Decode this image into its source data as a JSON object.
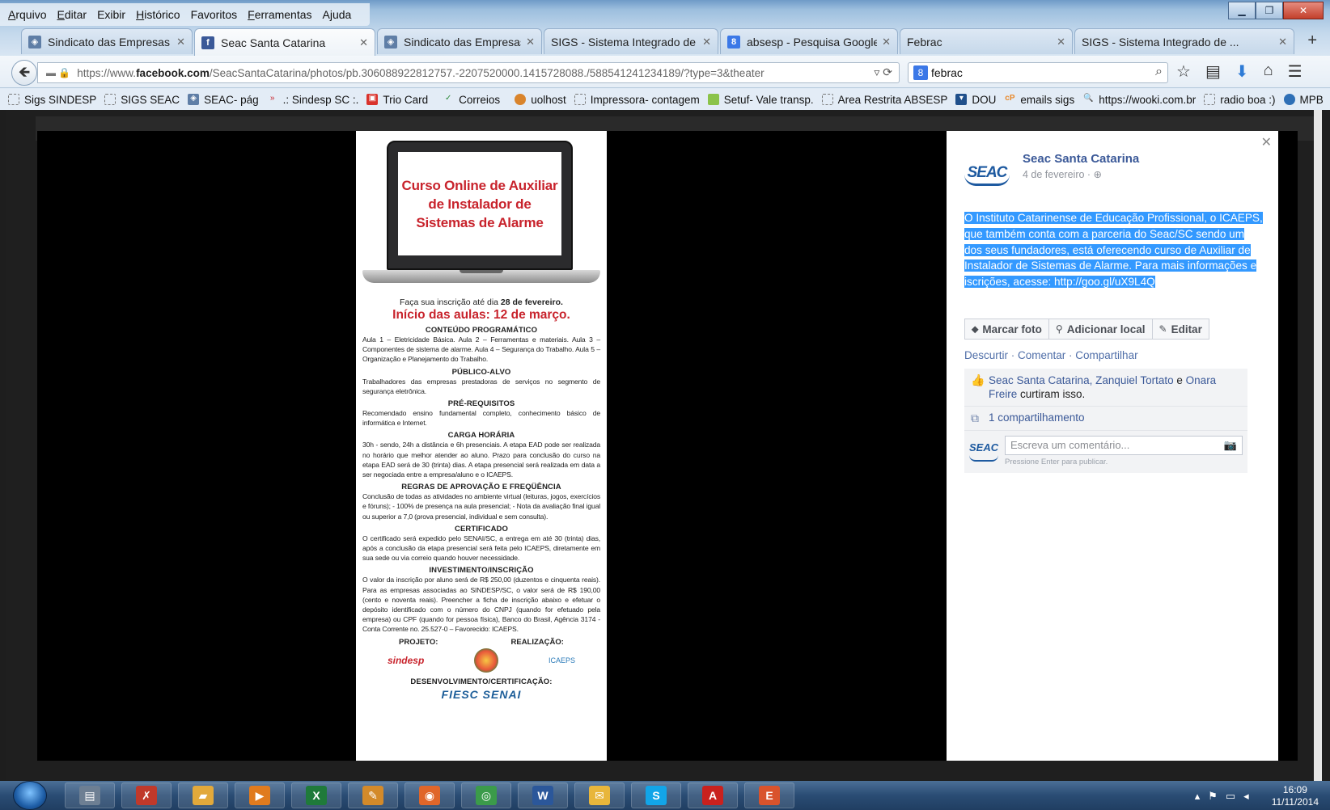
{
  "menubar": {
    "items": [
      {
        "label": "Arquivo",
        "key": "A",
        "rest": "rquivo"
      },
      {
        "label": "Editar",
        "key": "E",
        "rest": "ditar"
      },
      {
        "label": "Exibir",
        "key": "",
        "rest": ""
      },
      {
        "label": "Histórico",
        "key": "H",
        "rest": "istórico"
      },
      {
        "label": "Favoritos",
        "key": "",
        "rest": ""
      },
      {
        "label": "Ferramentas",
        "key": "F",
        "rest": "erramentas"
      },
      {
        "label": "Ajuda",
        "key": "",
        "rest": ""
      }
    ]
  },
  "tabs": [
    {
      "label": "Sindicato das Empresas ...",
      "icon": "seac-icon",
      "color": "#5f7ea6"
    },
    {
      "label": "Seac Santa Catarina",
      "icon": "facebook-icon",
      "color": "#3b5998"
    },
    {
      "label": "Sindicato das Empresas ...",
      "icon": "seac-icon",
      "color": "#5f7ea6"
    },
    {
      "label": "SIGS - Sistema Integrado de ...",
      "icon": "",
      "color": ""
    },
    {
      "label": "absesp - Pesquisa Google",
      "icon": "google-icon",
      "color": "#3b78e7"
    },
    {
      "label": "Febrac",
      "icon": "",
      "color": ""
    },
    {
      "label": "SIGS - Sistema Integrado de ...",
      "icon": "",
      "color": ""
    }
  ],
  "url": {
    "prefix": "https://www.",
    "domain": "facebook.com",
    "path": "/SeacSantaCatarina/photos/pb.306088922812757.-2207520000.1415728088./588541241234189/?type=3&theater"
  },
  "search": {
    "value": "febrac"
  },
  "bookmarks": [
    "Sigs SINDESP",
    "SIGS SEAC",
    "SEAC- pág",
    ".: Sindesp SC :.",
    "Trio Card",
    "Correios",
    "uolhost",
    "Impressora- contagem",
    "Setuf- Vale transp.",
    "Area Restrita ABSESP",
    "DOU",
    "emails sigs",
    "https://wooki.com.br",
    "radio boa :)",
    "MPB"
  ],
  "poster": {
    "title": "Curso Online de Auxiliar de Instalador de Sistemas de Alarme",
    "registration_pre": "Faça sua inscrição até dia ",
    "registration_date": "28 de fevereiro.",
    "start": "Início das aulas: 12 de março.",
    "sections": [
      {
        "heading": "CONTEÚDO PROGRAMÁTICO",
        "text": "Aula 1 – Eletricidade Básica. Aula 2 – Ferramentas e materiais. Aula 3 – Componentes de sistema de alarme. Aula 4 – Segurança do Trabalho. Aula 5 – Organização e Planejamento do Trabalho."
      },
      {
        "heading": "PÚBLICO-ALVO",
        "text": "Trabalhadores das empresas prestadoras de serviços no segmento de segurança eletrônica."
      },
      {
        "heading": "PRÉ-REQUISITOS",
        "text": "Recomendado ensino fundamental completo, conhecimento básico de informática e Internet."
      },
      {
        "heading": "CARGA HORÁRIA",
        "text": "30h - sendo, 24h a distância e 6h presenciais. A etapa EAD pode ser realizada no horário que melhor atender ao aluno. Prazo para conclusão do curso na etapa EAD será de 30 (trinta) dias. A etapa presencial será realizada em data a ser negociada entre a empresa/aluno e o ICAEPS."
      },
      {
        "heading": "REGRAS DE APROVAÇÃO E FREQÜÊNCIA",
        "text": "Conclusão de todas as atividades no ambiente virtual (leituras, jogos, exercícios e fóruns); - 100% de presença na aula presencial; - Nota da avaliação final igual ou superior a 7,0 (prova presencial, individual e sem consulta)."
      },
      {
        "heading": "CERTIFICADO",
        "text": "O certificado será expedido pelo SENAI/SC, a entrega em até 30 (trinta) dias, após a conclusão da etapa presencial será feita pelo ICAEPS, diretamente em sua sede ou via correio quando houver necessidade."
      },
      {
        "heading": "INVESTIMENTO/INSCRIÇÃO",
        "text": "O valor da inscrição por aluno será de R$ 250,00 (duzentos e cinquenta reais). Para as empresas associadas ao SINDESP/SC, o valor será de R$ 190,00 (cento e noventa reais). Preencher a ficha de inscrição abaixo e efetuar o depósito identificado com o número do CNPJ (quando for efetuado pela empresa) ou CPF (quando for pessoa física), Banco do Brasil, Agência 3174 - Conta Corrente no. 25.527-0 – Favorecido: ICAEPS."
      }
    ],
    "projeto": "PROJETO:",
    "realizacao": "REALIZAÇÃO:",
    "sindesp": "sindesp",
    "icaeps": "ICAEPS",
    "desenvolvimento": "DESENVOLVIMENTO/CERTIFICAÇÃO:",
    "fiesc": "FIESC SENAI"
  },
  "post": {
    "page_name": "Seac Santa Catarina",
    "logo_text": "SEAC",
    "date": "4 de fevereiro · ",
    "text": "O Instituto Catarinense de Educação Profissional, o ICAEPS, que também conta com a parceria do Seac/SC sendo um dos seus fundadores, está oferecendo curso de Auxiliar de Instalador de Sistemas de Alarme. Para mais informações e iscrições, acesse: http://goo.gl/uX9L4Q",
    "buttons": {
      "tag": "Marcar foto",
      "location": "Adicionar local",
      "edit": "Editar"
    },
    "links": {
      "unlike": "Descurtir",
      "comment": "Comentar",
      "share": "Compartilhar"
    },
    "likes": {
      "names": "Seac Santa Catarina, Zanquiel Tortato",
      "and": " e ",
      "last": "Onara Freire",
      "suffix": " curtiram isso."
    },
    "shares": "1 compartilhamento",
    "comment_placeholder": "Escreva um comentário...",
    "comment_hint": "Pressione Enter para publicar."
  },
  "taskbar": {
    "apps": [
      {
        "name": "server-manager-icon",
        "glyph": "▤",
        "color": "#6d7f93"
      },
      {
        "name": "task-icon",
        "glyph": "✗",
        "color": "#c0392b"
      },
      {
        "name": "explorer-icon",
        "glyph": "▰",
        "color": "#e2a93b"
      },
      {
        "name": "media-player-icon",
        "glyph": "▶",
        "color": "#e07b1e"
      },
      {
        "name": "excel-icon",
        "glyph": "X",
        "color": "#1f7a3a"
      },
      {
        "name": "paint-icon",
        "glyph": "✎",
        "color": "#d38a2a"
      },
      {
        "name": "firefox-icon",
        "glyph": "◉",
        "color": "#e0662a"
      },
      {
        "name": "chrome-icon",
        "glyph": "◎",
        "color": "#3b9b4a"
      },
      {
        "name": "word-icon",
        "glyph": "W",
        "color": "#2b579a"
      },
      {
        "name": "mail-icon",
        "glyph": "✉",
        "color": "#e8b63b"
      },
      {
        "name": "skype-icon",
        "glyph": "S",
        "color": "#12a5e8"
      },
      {
        "name": "pdf-icon",
        "glyph": "A",
        "color": "#c9211e"
      },
      {
        "name": "app-icon",
        "glyph": "E",
        "color": "#d9532c"
      }
    ],
    "time": "16:09",
    "date": "11/11/2014"
  }
}
